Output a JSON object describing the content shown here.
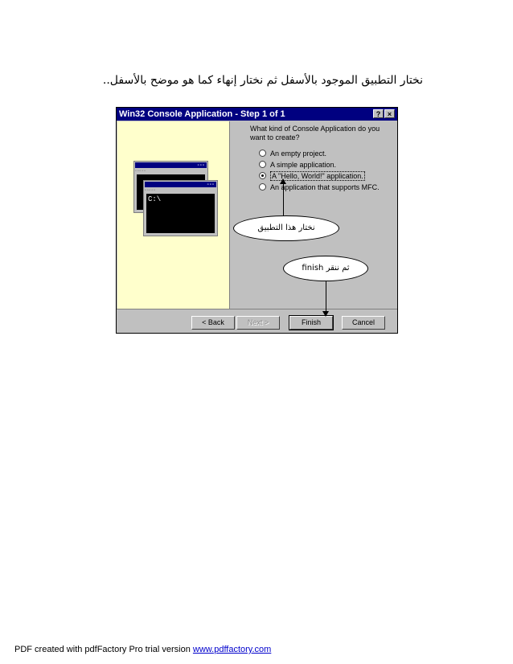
{
  "caption": "نختار التطبيق الموجود بالأسفل ثم نختار إنهاء كما هو موضح بالأسفل..",
  "dialog": {
    "title": "Win32 Console Application - Step 1 of 1",
    "help_button": "?",
    "close_button": "×",
    "question": "What kind of Console Application do you want to create?",
    "options": [
      {
        "label": "An empty project.",
        "selected": false
      },
      {
        "label": "A simple application.",
        "selected": false
      },
      {
        "label": "A \"Hello, World!\" application.",
        "selected": true
      },
      {
        "label": "An application that supports MFC.",
        "selected": false
      }
    ],
    "console_prompt": "C:\\",
    "buttons": {
      "back": "< Back",
      "next": "Next >",
      "finish": "Finish",
      "cancel": "Cancel"
    }
  },
  "callouts": {
    "choose_app": "نختار هذا التطبيق",
    "then_click": "ثم ننقر finish"
  },
  "footer": {
    "text": "PDF created with pdfFactory Pro trial version ",
    "link": "www.pdffactory.com"
  }
}
